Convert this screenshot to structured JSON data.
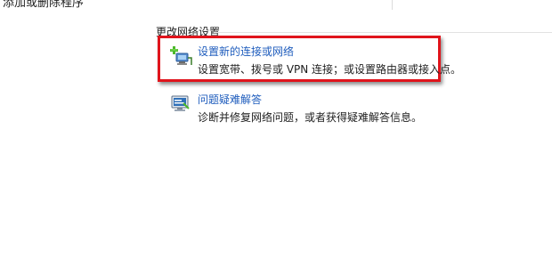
{
  "top": {
    "clipped_text": "添加或删除程序"
  },
  "section": {
    "title": "更改网络设置"
  },
  "tasks": [
    {
      "icon": "new-connection-icon",
      "link": "设置新的连接或网络",
      "description": "设置宽带、拨号或 VPN 连接；或设置路由器或接入点。"
    },
    {
      "icon": "troubleshoot-icon",
      "link": "问题疑难解答",
      "description": "诊断并修复网络问题，或者获得疑难解答信息。"
    }
  ],
  "colors": {
    "link": "#1f5dbd",
    "highlight": "#e0141c",
    "text": "#1e1e1e"
  }
}
